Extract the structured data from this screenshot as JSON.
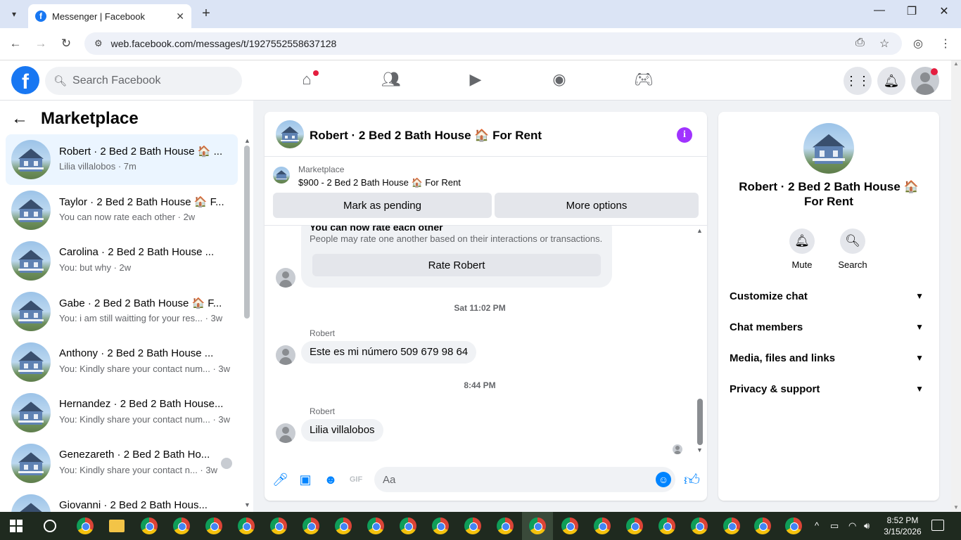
{
  "browser": {
    "tab_title": "Messenger | Facebook",
    "url": "web.facebook.com/messages/t/1927552558637128"
  },
  "fb": {
    "search_placeholder": "Search Facebook"
  },
  "left_panel": {
    "title": "Marketplace",
    "conversations": [
      {
        "name": "Robert · 2 Bed 2 Bath House 🏠 ...",
        "snippet": "Lilia villalobos · 7m",
        "active": true
      },
      {
        "name": "Taylor · 2 Bed 2 Bath House 🏠 F...",
        "snippet": "You can now rate each other · 2w"
      },
      {
        "name": "Carolina · 2 Bed 2 Bath House ...",
        "snippet": "You: but why · 2w"
      },
      {
        "name": "Gabe · 2 Bed 2 Bath House 🏠 F...",
        "snippet": "You: i am still waitting for your res...  · 3w"
      },
      {
        "name": "Anthony · 2 Bed 2 Bath House ...",
        "snippet": "You: Kindly share your contact num... · 3w"
      },
      {
        "name": "Hernandez · 2 Bed 2 Bath House...",
        "snippet": "You: Kindly share your contact num... · 3w"
      },
      {
        "name": "Genezareth · 2 Bed 2 Bath Ho...",
        "snippet": "You: Kindly share your contact n... · 3w"
      },
      {
        "name": "Giovanni · 2 Bed 2 Bath Hous...",
        "snippet": ""
      }
    ]
  },
  "chat": {
    "title": "Robert · 2 Bed 2 Bath House 🏠 For Rent",
    "marketplace_label": "Marketplace",
    "item": "$900 - 2 Bed 2 Bath House 🏠 For Rent",
    "mark_pending": "Mark as pending",
    "more_options": "More options",
    "system_title": "You can now rate each other",
    "system_desc": "People may rate one another based on their interactions or transactions.",
    "rate_button": "Rate Robert",
    "time1": "Sat 11:02 PM",
    "sender1": "Robert",
    "msg1": "Este es mi número 509 679 98 64",
    "time2": "8:44 PM",
    "sender2": "Robert",
    "msg2": "Lilia villalobos",
    "input_placeholder": "Aa"
  },
  "info_panel": {
    "name": "Robert · 2 Bed 2 Bath House 🏠 For Rent",
    "mute": "Mute",
    "search": "Search",
    "sections": [
      "Customize chat",
      "Chat members",
      "Media, files and links",
      "Privacy & support"
    ]
  },
  "taskbar": {
    "time": "8:52 PM",
    "date": "3/15/2026"
  },
  "colors": {
    "facebook_blue": "#1877f2",
    "messenger_blue": "#0084ff",
    "info_purple": "#a033ff",
    "active_row": "#ebf5ff"
  }
}
